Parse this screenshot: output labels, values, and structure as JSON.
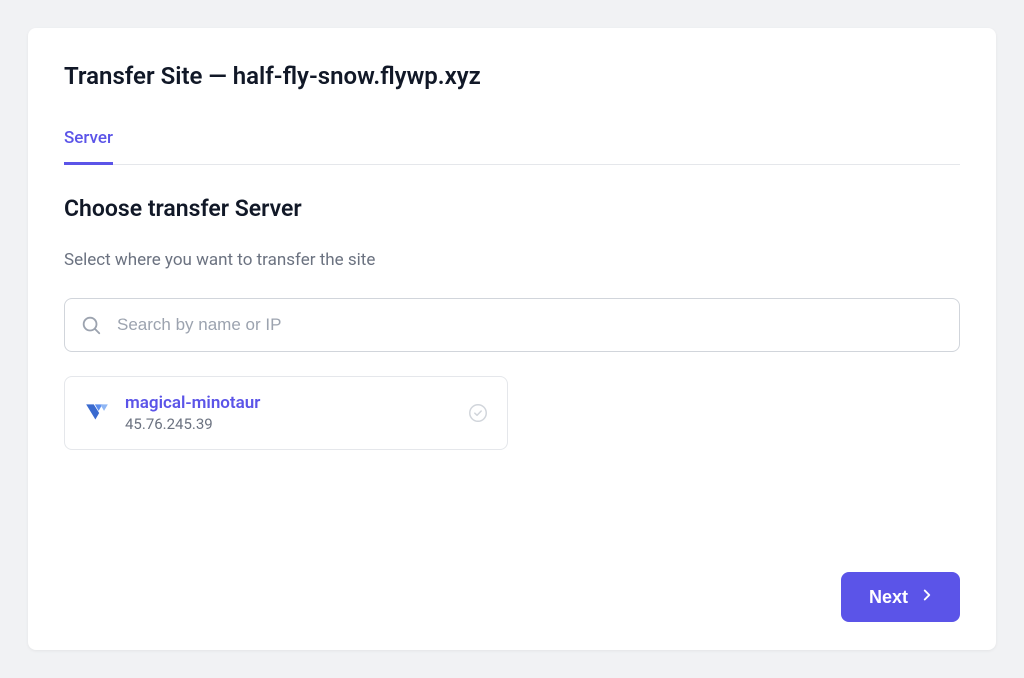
{
  "header": {
    "title": "Transfer Site — half-fly-snow.flywp.xyz"
  },
  "tabs": {
    "server": "Server"
  },
  "section": {
    "title": "Choose transfer Server",
    "subtitle": "Select where you want to transfer the site"
  },
  "search": {
    "placeholder": "Search by name or IP"
  },
  "servers": [
    {
      "name": "magical-minotaur",
      "ip": "45.76.245.39"
    }
  ],
  "footer": {
    "next": "Next"
  }
}
